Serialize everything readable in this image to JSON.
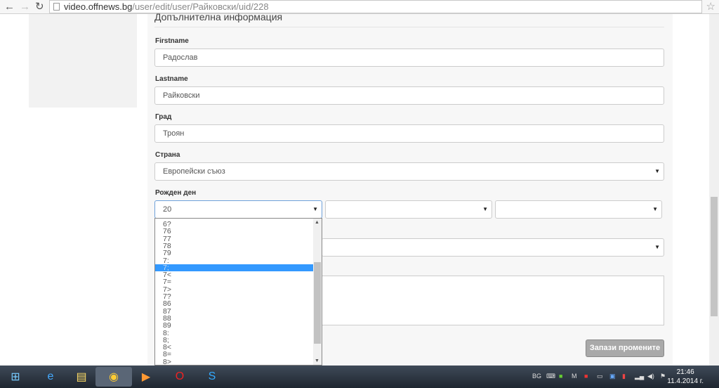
{
  "browser": {
    "url_host": "video.offnews.bg",
    "url_path": "/user/edit/user/Райковски/uid/228"
  },
  "form": {
    "heading": "Допълнителна информация",
    "firstname_label": "Firstname",
    "firstname_value": "Радослав",
    "lastname_label": "Lastname",
    "lastname_value": "Райковски",
    "city_label": "Град",
    "city_value": "Троян",
    "country_label": "Страна",
    "country_value": "Европейски съюз",
    "birthday_label": "Рожден ден",
    "day_value": "20",
    "month_value": "",
    "year_value": "",
    "save_label": "Запази промените"
  },
  "dropdown": {
    "options": [
      "6?",
      "76",
      "77",
      "78",
      "79",
      "7:",
      "7;",
      "7<",
      "7=",
      "7>",
      "7?",
      "86",
      "87",
      "88",
      "89",
      "8:",
      "8;",
      "8<",
      "8=",
      "8>"
    ],
    "selected_index": 6
  },
  "taskbar": {
    "lang": "BG",
    "time": "21:46",
    "date": "11.4.2014 г."
  }
}
